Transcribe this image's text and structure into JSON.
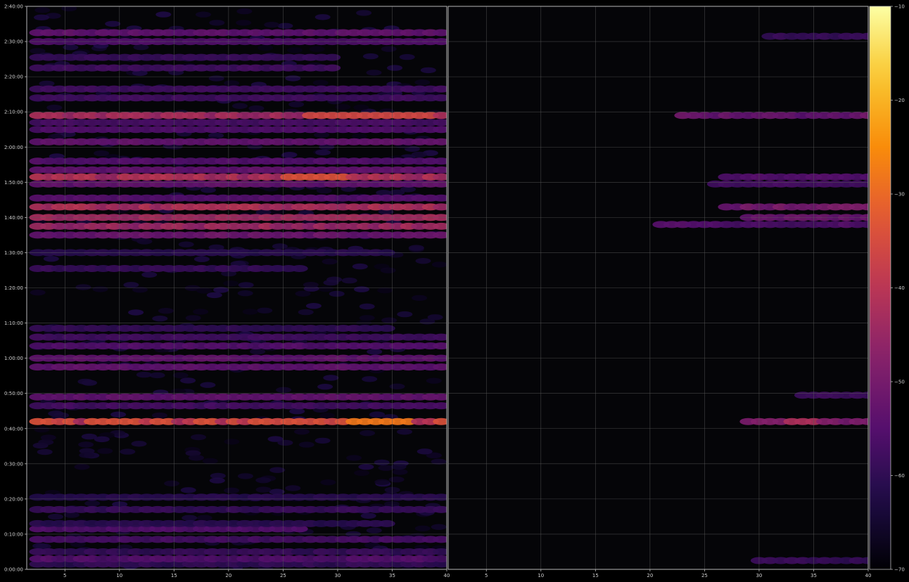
{
  "chart_data": {
    "type": "heatmap",
    "colormap": "inferno",
    "background": "#050508",
    "colorbar": {
      "vmin": -70,
      "vmax": -10,
      "ticks": [
        -10,
        -20,
        -30,
        -40,
        -50,
        -60,
        -70
      ]
    },
    "x_ticks": [
      5,
      10,
      15,
      20,
      25,
      30,
      35,
      40
    ],
    "xlim": [
      1.5,
      40
    ],
    "y_ticks": [
      "0:00:00",
      "0:10:00",
      "0:20:00",
      "0:30:00",
      "0:40:00",
      "0:50:00",
      "1:00:00",
      "1:10:00",
      "1:20:00",
      "1:30:00",
      "1:40:00",
      "1:50:00",
      "2:00:00",
      "2:10:00",
      "2:20:00",
      "2:30:00",
      "2:40:00"
    ],
    "ylim_minutes": [
      0,
      160
    ],
    "grid": true,
    "panels": [
      {
        "name": "left",
        "bands": [
          {
            "t": 1.5,
            "min": -64,
            "max": -58,
            "x0": 2.5,
            "x1": 40
          },
          {
            "t": 3,
            "min": -60,
            "max": -54,
            "x0": 2.5,
            "x1": 40
          },
          {
            "t": 5,
            "min": -63,
            "max": -58,
            "x0": 2.5,
            "x1": 40
          },
          {
            "t": 8.5,
            "min": -60,
            "max": -56,
            "x0": 2.5,
            "x1": 40
          },
          {
            "t": 11.5,
            "min": -58,
            "max": -55,
            "x0": 2.5,
            "x1": 27
          },
          {
            "t": 13,
            "min": -63,
            "max": -60,
            "x0": 2.5,
            "x1": 35
          },
          {
            "t": 17,
            "min": -62,
            "max": -58,
            "x0": 2.5,
            "x1": 40
          },
          {
            "t": 20.5,
            "min": -63,
            "max": -60,
            "x0": 2.5,
            "x1": 40
          },
          {
            "t": 42,
            "min": -52,
            "max": -28,
            "x0": 2.5,
            "x1": 40,
            "peak": 34,
            "width": 3
          },
          {
            "t": 46.5,
            "min": -60,
            "max": -56,
            "x0": 2.5,
            "x1": 40
          },
          {
            "t": 49,
            "min": -56,
            "max": -52,
            "x0": 2.5,
            "x1": 40
          },
          {
            "t": 57.5,
            "min": -56,
            "max": -52,
            "x0": 2.5,
            "x1": 40
          },
          {
            "t": 60,
            "min": -56,
            "max": -52,
            "x0": 2.5,
            "x1": 40
          },
          {
            "t": 63.5,
            "min": -58,
            "max": -54,
            "x0": 2.5,
            "x1": 40
          },
          {
            "t": 66,
            "min": -60,
            "max": -57,
            "x0": 2.5,
            "x1": 40
          },
          {
            "t": 68.5,
            "min": -62,
            "max": -59,
            "x0": 2.5,
            "x1": 35
          },
          {
            "t": 85.5,
            "min": -62,
            "max": -58,
            "x0": 2.5,
            "x1": 27
          },
          {
            "t": 90,
            "min": -63,
            "max": -60,
            "x0": 2.5,
            "x1": 35
          },
          {
            "t": 95,
            "min": -56,
            "max": -50,
            "x0": 2.5,
            "x1": 40
          },
          {
            "t": 97.5,
            "min": -50,
            "max": -42,
            "x0": 2.5,
            "x1": 40
          },
          {
            "t": 100,
            "min": -48,
            "max": -42,
            "x0": 2.5,
            "x1": 40
          },
          {
            "t": 103,
            "min": -48,
            "max": -40,
            "x0": 2.5,
            "x1": 40
          },
          {
            "t": 105.5,
            "min": -58,
            "max": -54,
            "x0": 2.5,
            "x1": 40
          },
          {
            "t": 109.5,
            "min": -56,
            "max": -52,
            "x0": 2.5,
            "x1": 40
          },
          {
            "t": 111.5,
            "min": -52,
            "max": -34,
            "x0": 2.5,
            "x1": 40,
            "peak": 28,
            "width": 3
          },
          {
            "t": 113.5,
            "min": -56,
            "max": -52,
            "x0": 2.5,
            "x1": 40
          },
          {
            "t": 116,
            "min": -58,
            "max": -54,
            "x0": 2.5,
            "x1": 40
          },
          {
            "t": 121.5,
            "min": -55,
            "max": -52,
            "x0": 2.5,
            "x1": 40
          },
          {
            "t": 125,
            "min": -58,
            "max": -55,
            "x0": 2.5,
            "x1": 40
          },
          {
            "t": 127,
            "min": -59,
            "max": -56,
            "x0": 2.5,
            "x1": 40
          },
          {
            "t": 129,
            "min": -52,
            "max": -36,
            "x0": 2.5,
            "x1": 40,
            "peak": 33,
            "width": 6
          },
          {
            "t": 134,
            "min": -60,
            "max": -57,
            "x0": 2.5,
            "x1": 40
          },
          {
            "t": 136.5,
            "min": -60,
            "max": -57,
            "x0": 2.5,
            "x1": 40
          },
          {
            "t": 142.5,
            "min": -60,
            "max": -57,
            "x0": 2.5,
            "x1": 30
          },
          {
            "t": 145.5,
            "min": -61,
            "max": -58,
            "x0": 2.5,
            "x1": 30
          },
          {
            "t": 150,
            "min": -58,
            "max": -55,
            "x0": 2.5,
            "x1": 40
          },
          {
            "t": 152.5,
            "min": -56,
            "max": -52,
            "x0": 2.5,
            "x1": 40
          }
        ]
      },
      {
        "name": "right",
        "bands": [
          {
            "t": 2.5,
            "min": -62,
            "max": -58,
            "x0": 30,
            "x1": 40
          },
          {
            "t": 42,
            "min": -56,
            "max": -42,
            "x0": 29,
            "x1": 40,
            "peak": 34,
            "width": 2
          },
          {
            "t": 49.5,
            "min": -60,
            "max": -57,
            "x0": 34,
            "x1": 40
          },
          {
            "t": 98,
            "min": -60,
            "max": -54,
            "x0": 21,
            "x1": 40
          },
          {
            "t": 100,
            "min": -56,
            "max": -50,
            "x0": 29,
            "x1": 40
          },
          {
            "t": 103,
            "min": -56,
            "max": -48,
            "x0": 27,
            "x1": 40
          },
          {
            "t": 109.5,
            "min": -60,
            "max": -56,
            "x0": 26,
            "x1": 40
          },
          {
            "t": 111.5,
            "min": -58,
            "max": -54,
            "x0": 27,
            "x1": 40
          },
          {
            "t": 129,
            "min": -58,
            "max": -50,
            "x0": 23,
            "x1": 40
          },
          {
            "t": 151.5,
            "min": -62,
            "max": -58,
            "x0": 31,
            "x1": 40
          }
        ]
      }
    ]
  }
}
